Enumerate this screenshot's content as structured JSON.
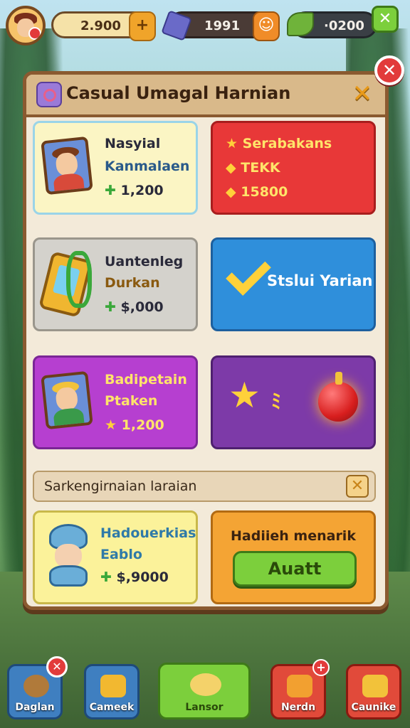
{
  "topbar": {
    "coins": "2.900",
    "coins_plus": "+",
    "gems": "1991",
    "gems_plus": "☺",
    "leaves": "·0200",
    "close_icon": "✕"
  },
  "panel": {
    "title": "Casual Umagal Harnian",
    "header_close": "✕",
    "outer_close": "✕"
  },
  "cards": [
    {
      "line1": "Nasyial",
      "line2": "Kanmalaen",
      "price": "1,200",
      "price_icon": "leaf-icon"
    },
    {
      "line1": "Serabakans",
      "line2": "TEKK",
      "price": "15800",
      "price_icon": "star-icon"
    },
    {
      "line1": "Uantenleg",
      "line2": "Durkan",
      "price": "$,000",
      "price_icon": "leaf-icon"
    },
    {
      "line1": "Stslui Yarian"
    },
    {
      "line1": "Badipetain",
      "line2": "Ptaken",
      "price": "1,200",
      "price_icon": "star-icon"
    },
    {
      "line1": ""
    },
    {
      "line1": "Hadouerkias",
      "line2": "Eablo",
      "price": "$,9000",
      "price_icon": "leaf-icon"
    },
    {
      "line1": "Hadiieh menarik",
      "button": "Auatt"
    }
  ],
  "section": {
    "label": "Sarkengirnaian laraian",
    "close": "✕"
  },
  "bottom_nav": [
    {
      "label": "Daglan",
      "badge": "✕"
    },
    {
      "label": "Cameek"
    },
    {
      "label": "Lansor"
    },
    {
      "label": "Nerdn",
      "badge": "+"
    },
    {
      "label": "Caunike"
    }
  ],
  "colors": {
    "panel_border": "#8a5a30",
    "accent_green": "#7ccf3c",
    "accent_red": "#e23b3b",
    "accent_blue": "#2f8fdb",
    "accent_purple": "#b63fd0"
  }
}
